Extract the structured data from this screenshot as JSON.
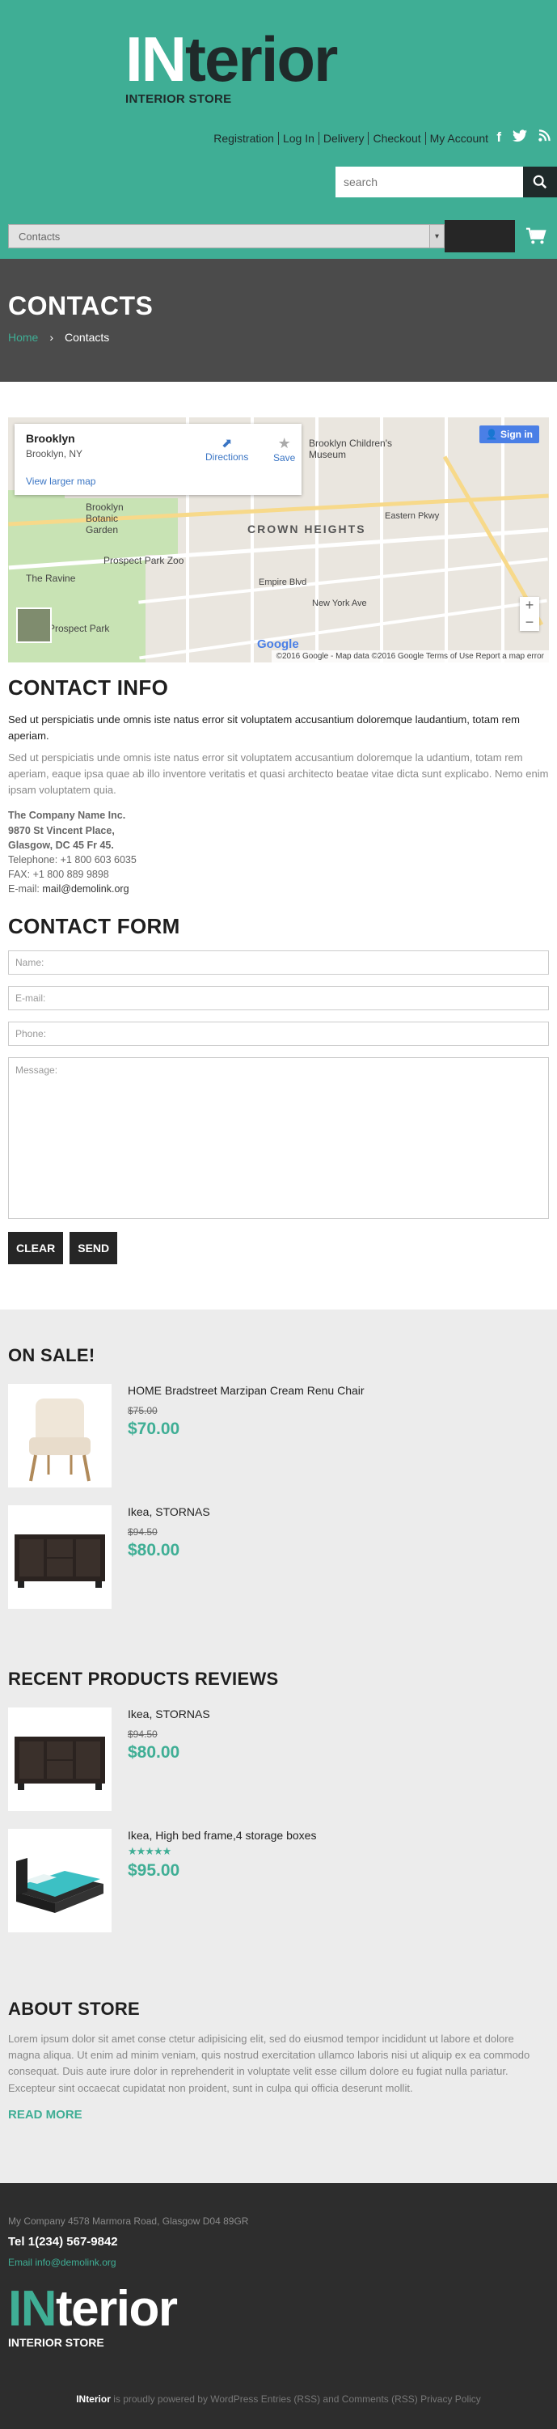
{
  "brand": {
    "logo_in": "IN",
    "logo_rest": "terior",
    "subtitle": "INTERIOR STORE"
  },
  "topnav": [
    "Registration",
    "Log In",
    "Delivery",
    "Checkout",
    "My Account"
  ],
  "social": [
    "facebook-icon",
    "twitter-icon",
    "rss-icon"
  ],
  "search": {
    "placeholder": "search"
  },
  "menu": {
    "selected": "Contacts"
  },
  "page": {
    "title": "CONTACTS",
    "breadcrumb_home": "Home",
    "breadcrumb_sep": "›",
    "breadcrumb_current": "Contacts"
  },
  "map": {
    "place": "Brooklyn",
    "place_sub": "Brooklyn, NY",
    "larger": "View larger map",
    "directions": "Directions",
    "save": "Save",
    "signin": "Sign in",
    "labels": [
      "Brooklyn Children's Museum",
      "Brooklyn Botanic Garden",
      "CROWN HEIGHTS",
      "Prospect Park Zoo",
      "The Ravine",
      "Eastern Pkwy",
      "Empire Blvd",
      "New York Ave",
      "Prospect Park"
    ],
    "footer": "©2016 Google - Map data ©2016 Google   Terms of Use   Report a map error",
    "google": "Google"
  },
  "contact_info": {
    "heading": "CONTACT INFO",
    "lead": "Sed ut perspiciatis unde omnis iste natus error sit voluptatem accusantium doloremque laudantium, totam rem aperiam.",
    "para": "Sed ut perspiciatis unde omnis iste natus error sit voluptatem accusantium doloremque la udantium, totam rem aperiam, eaque ipsa quae ab illo inventore veritatis et quasi architecto beatae vitae dicta sunt explicabo. Nemo enim ipsam voluptatem quia.",
    "company": "The Company Name Inc.",
    "street": "9870 St Vincent Place,",
    "city": "Glasgow, DC 45 Fr 45.",
    "telephone": "Telephone: +1 800 603 6035",
    "fax": "FAX: +1 800 889 9898",
    "email_label": "E-mail: ",
    "email": "mail@demolink.org"
  },
  "contact_form": {
    "heading": "CONTACT FORM",
    "name": "Name:",
    "email": "E-mail:",
    "phone": "Phone:",
    "message": "Message:",
    "clear": "CLEAR",
    "send": "SEND"
  },
  "on_sale": {
    "heading": "ON SALE!",
    "items": [
      {
        "name": "HOME Bradstreet Marzipan Cream Renu Chair",
        "old": "$75.00",
        "price": "$70.00"
      },
      {
        "name": "Ikea, STORNAS",
        "old": "$94.50",
        "price": "$80.00"
      }
    ]
  },
  "reviews": {
    "heading": "RECENT PRODUCTS REVIEWS",
    "items": [
      {
        "name": "Ikea, STORNAS",
        "old": "$94.50",
        "price": "$80.00"
      },
      {
        "name": "Ikea, High bed frame,4 storage boxes",
        "rating": 5,
        "stars": "★★★★★",
        "price": "$95.00"
      }
    ]
  },
  "about": {
    "heading": "ABOUT STORE",
    "text": "Lorem ipsum dolor sit amet conse ctetur adipisicing elit, sed do eiusmod tempor incididunt ut labore et dolore magna aliqua. Ut enim ad minim veniam, quis nostrud exercitation ullamco laboris nisi ut aliquip ex ea commodo consequat. Duis aute irure dolor in reprehenderit in voluptate velit esse cillum dolore eu fugiat nulla pariatur. Excepteur sint occaecat cupidatat non proident, sunt in culpa qui officia deserunt mollit.",
    "more": "READ MORE"
  },
  "footer": {
    "address": "My Company 4578 Marmora Road, Glasgow D04 89GR",
    "tel": "Tel 1(234) 567-9842",
    "email": "Email info@demolink.org",
    "copy_brand": "INterior",
    "copy_text": " is proudly powered by WordPress Entries (RSS) and Comments (RSS) Privacy Policy"
  },
  "colors": {
    "accent": "#3fae95",
    "dark": "#262626",
    "title_bar": "#4b4b4b",
    "footer": "#2d2d2d"
  }
}
